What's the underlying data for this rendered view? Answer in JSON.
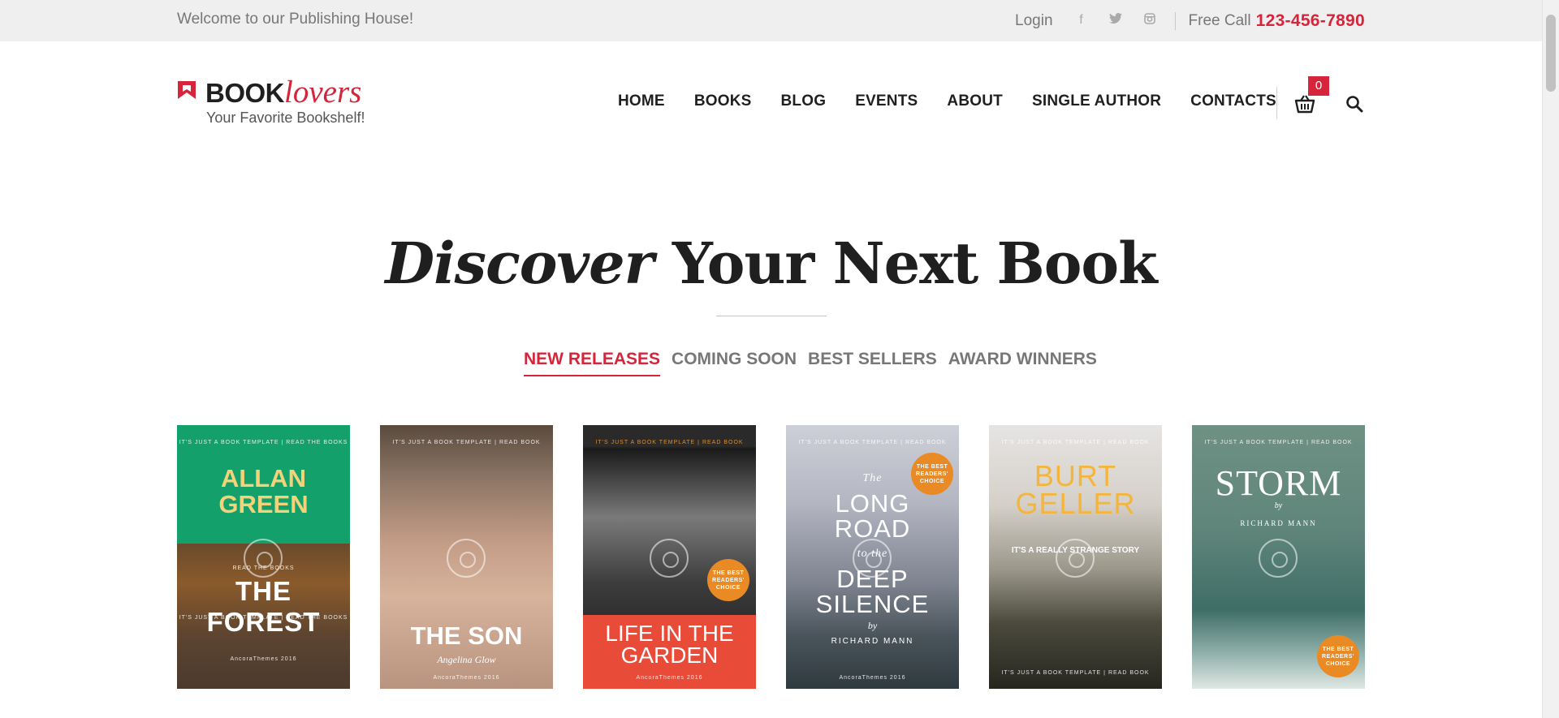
{
  "topbar": {
    "welcome": "Welcome to our Publishing House!",
    "login": "Login",
    "social_icons": [
      "facebook-icon",
      "twitter-icon",
      "instagram-icon"
    ],
    "free_call_label": "Free Call",
    "phone": "123-456-7890"
  },
  "logo": {
    "title_bold": "BOOK",
    "title_italic": "lovers",
    "tagline": "Your Favorite Bookshelf!"
  },
  "nav": {
    "items": [
      "HOME",
      "BOOKS",
      "BLOG",
      "EVENTS",
      "ABOUT",
      "SINGLE AUTHOR",
      "CONTACTS"
    ],
    "cart_count": "0"
  },
  "hero": {
    "title_italic": "Discover",
    "title_rest": " Your Next Book"
  },
  "tabs": [
    {
      "label": "NEW RELEASES",
      "active": true
    },
    {
      "label": "COMING SOON",
      "active": false
    },
    {
      "label": "BEST SELLERS",
      "active": false
    },
    {
      "label": "AWARD WINNERS",
      "active": false
    }
  ],
  "books": [
    {
      "top_line": "IT'S JUST A BOOK TEMPLATE | READ THE BOOKS",
      "author_line1": "ALLAN",
      "author_line2": "GREEN",
      "pre": "READ THE BOOKS",
      "title": "THE FOREST",
      "sub_line": "IT'S JUST A BOOK TEMPLATE | READ THE BOOKS",
      "footer": "AncoraThemes 2016"
    },
    {
      "top_line": "IT'S JUST A BOOK TEMPLATE | READ BOOK",
      "title": "THE SON",
      "subtitle": "Angelina Glow",
      "footer": "AncoraThemes 2016"
    },
    {
      "top_line": "IT'S JUST A BOOK TEMPLATE | READ BOOK",
      "badge": "THE BEST READERS' CHOICE",
      "title_line1": "LIFE IN THE",
      "title_line2": "GARDEN",
      "footer": "AncoraThemes 2016"
    },
    {
      "top_line": "IT'S JUST A BOOK TEMPLATE | READ BOOK",
      "badge": "THE BEST READERS' CHOICE",
      "the": "The",
      "t1": "LONG",
      "t2": "ROAD",
      "to_the": "to the",
      "t3": "DEEP",
      "t4": "SILENCE",
      "by": "by",
      "author": "RICHARD MANN",
      "footer": "AncoraThemes 2016"
    },
    {
      "top_line": "IT'S JUST A BOOK TEMPLATE | READ BOOK",
      "title_line1": "BURT",
      "title_line2": "GELLER",
      "tagline": "IT'S A REALLY STRANGE STORY",
      "footer": "IT'S JUST A BOOK TEMPLATE | READ BOOK"
    },
    {
      "top_line": "IT'S JUST A BOOK TEMPLATE | READ BOOK",
      "title": "STORM",
      "by": "by",
      "author": "RICHARD MANN",
      "badge": "THE BEST READERS' CHOICE"
    }
  ]
}
